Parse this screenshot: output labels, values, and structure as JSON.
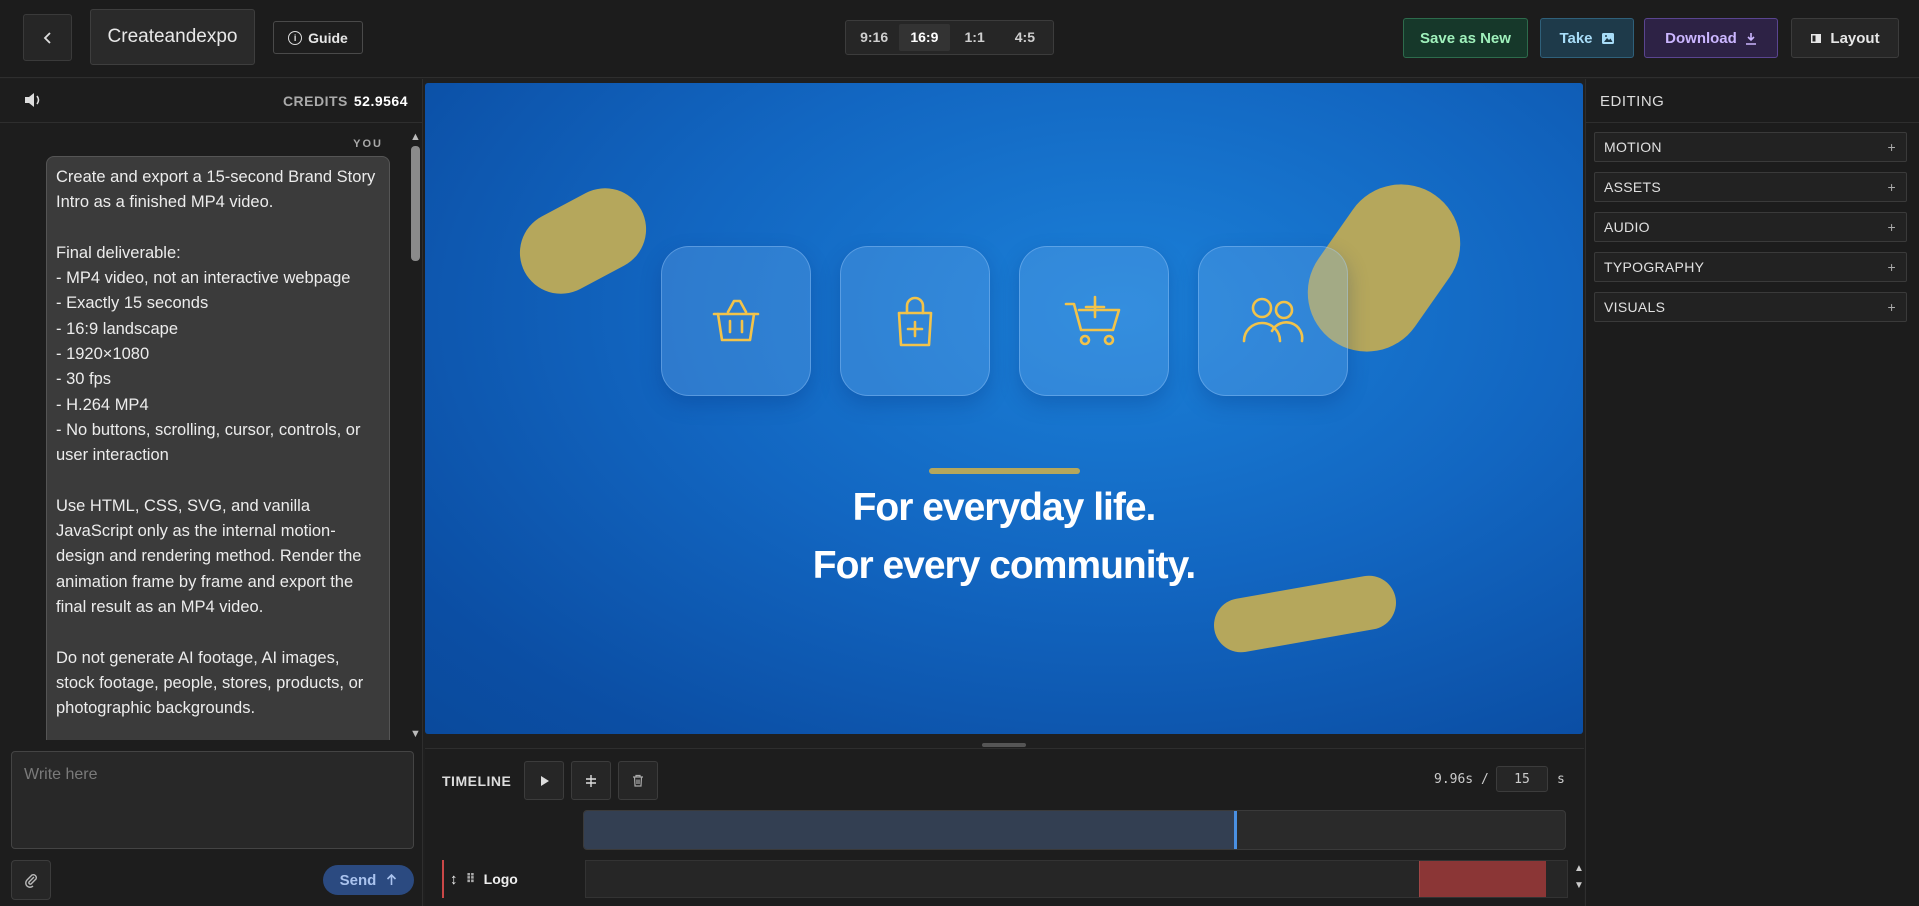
{
  "topbar": {
    "back_icon": "chevron-left-icon",
    "project_name": "Createandexpo",
    "guide_label": "Guide",
    "ratios": [
      "9:16",
      "16:9",
      "1:1",
      "4:5"
    ],
    "active_ratio": "16:9",
    "save_label": "Save as New",
    "take_label": "Take",
    "download_label": "Download",
    "layout_label": "Layout"
  },
  "sidebar": {
    "credits_label": "CREDITS",
    "credits_value": "52.9564",
    "you_label": "YOU",
    "message": "Create and export a 15-second Brand Story Intro as a finished MP4 video.\n\nFinal deliverable:\n- MP4 video, not an interactive webpage\n- Exactly 15 seconds\n- 16:9 landscape\n- 1920×1080\n- 30 fps\n- H.264 MP4\n- No buttons, scrolling, cursor, controls, or user interaction\n\nUse HTML, CSS, SVG, and vanilla JavaScript only as the internal motion-design and rendering method. Render the animation frame by frame and export the final result as an MP4 video.\n\nDo not generate AI footage, AI images, stock footage, people, stores, products, or photographic backgrounds.",
    "input_placeholder": "Write here",
    "send_label": "Send"
  },
  "preview": {
    "line1": "For everyday life.",
    "line2": "For every community.",
    "icons": [
      "basket-icon",
      "shopping-bag-icon",
      "cart-icon",
      "community-icon"
    ],
    "colors": {
      "background": "#1266c1",
      "accent": "#b5a75c",
      "icon": "#f2c34a"
    }
  },
  "timeline": {
    "label": "TIMELINE",
    "current_time": "9.96s /",
    "duration": "15",
    "unit": "s",
    "progress": 0.664,
    "tracks": [
      {
        "name": "Logo",
        "clip_start": 0.849,
        "clip_end": 0.979
      }
    ]
  },
  "editing": {
    "title": "EDITING",
    "sections": [
      "MOTION",
      "ASSETS",
      "AUDIO",
      "TYPOGRAPHY",
      "VISUALS"
    ]
  }
}
